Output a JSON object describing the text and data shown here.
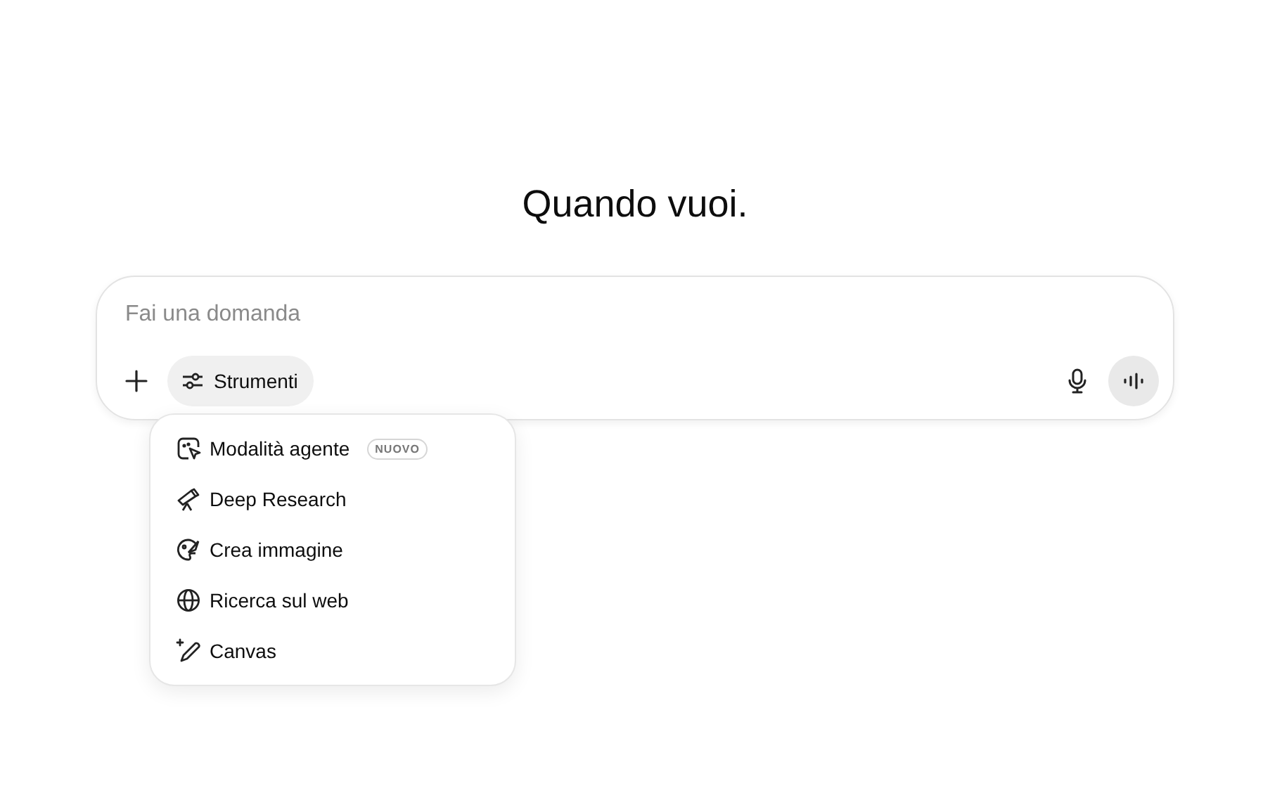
{
  "heading": "Quando vuoi.",
  "composer": {
    "placeholder": "Fai una domanda",
    "tools_button": "Strumenti"
  },
  "tools_menu": [
    {
      "kind": "agent",
      "label": "Modalità agente",
      "badge": "NUOVO"
    },
    {
      "kind": "research",
      "label": "Deep Research"
    },
    {
      "kind": "image",
      "label": "Crea immagine"
    },
    {
      "kind": "web",
      "label": "Ricerca sul web"
    },
    {
      "kind": "canvas",
      "label": "Canvas"
    }
  ]
}
